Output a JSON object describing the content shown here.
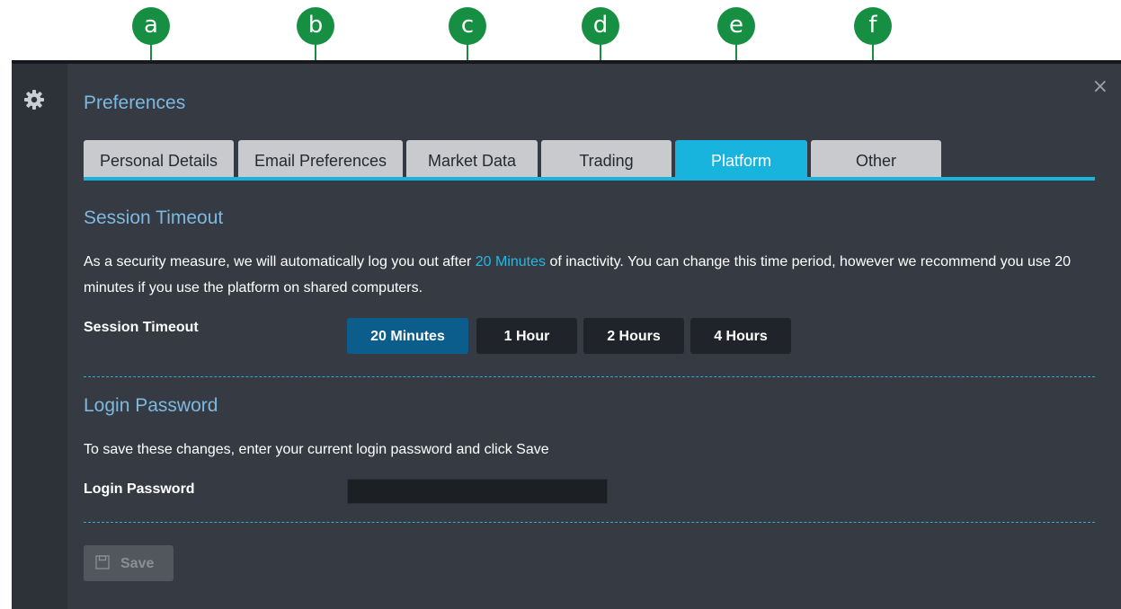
{
  "callouts": [
    "a",
    "b",
    "c",
    "d",
    "e",
    "f"
  ],
  "window": {
    "title": "Preferences",
    "close_glyph": "×"
  },
  "icons": {
    "settings": "gear-icon",
    "close": "close-icon",
    "save": "floppy-disk-icon"
  },
  "tabs": [
    {
      "label": "Personal Details",
      "active": false
    },
    {
      "label": "Email Preferences",
      "active": false
    },
    {
      "label": "Market Data",
      "active": false
    },
    {
      "label": "Trading",
      "active": false
    },
    {
      "label": "Platform",
      "active": true
    },
    {
      "label": "Other",
      "active": false
    }
  ],
  "session": {
    "heading": "Session Timeout",
    "desc_prefix": "As a security measure, we will automatically log you out after ",
    "desc_highlight": "20 Minutes",
    "desc_suffix": " of inactivity. You can change this time period, however we recommend you use 20 minutes if you use the platform on shared computers.",
    "label": "Session Timeout",
    "options": [
      "20 Minutes",
      "1 Hour",
      "2 Hours",
      "4 Hours"
    ],
    "selected": "20 Minutes"
  },
  "login": {
    "heading": "Login Password",
    "desc": "To save these changes, enter your current login password and click Save",
    "label": "Login Password",
    "value": ""
  },
  "save_label": "Save",
  "colors": {
    "accent": "#19b4de",
    "callout": "#178f43",
    "panel": "#363b43",
    "selected_option": "#0b5e8c"
  }
}
